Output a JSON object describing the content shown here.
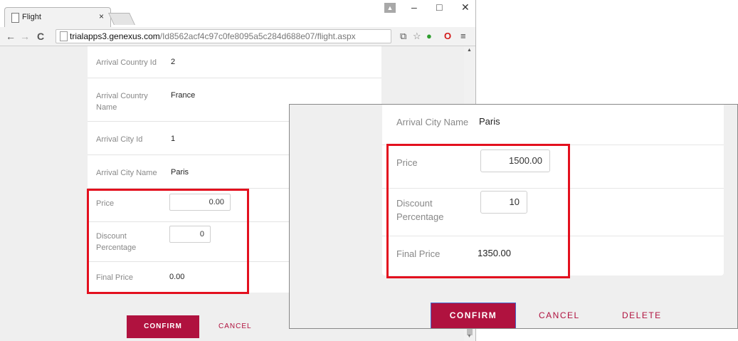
{
  "browser": {
    "tab_title": "Flight",
    "tab_close": "×",
    "url_prefix": "trialapps3.genexus.com",
    "url_path": "/Id8562acf4c97c0fe8095a5c284d688e07/flight.aspx",
    "minimize": "–",
    "maximize": "□",
    "close": "✕",
    "back": "←",
    "forward": "→",
    "reload": "C",
    "menu": "≡"
  },
  "form": {
    "rows": [
      {
        "label": "Arrival Country Id",
        "value": "2"
      },
      {
        "label": "Arrival Country Name",
        "value": "France"
      },
      {
        "label": "Arrival City Id",
        "value": "1"
      },
      {
        "label": "Arrival City Name",
        "value": "Paris"
      }
    ],
    "price_label": "Price",
    "price_value": "0.00",
    "discount_label": "Discount Percentage",
    "discount_value": "0",
    "final_price_label": "Final Price",
    "final_price_value": "0.00",
    "confirm_label": "CONFIRM",
    "cancel_label": "CANCEL"
  },
  "zoom": {
    "city_label": "Arrival City Name",
    "city_value": "Paris",
    "price_label": "Price",
    "price_value": "1500.00",
    "discount_label": "Discount Percentage",
    "discount_value": "10",
    "final_price_label": "Final Price",
    "final_price_value": "1350.00",
    "confirm_label": "CONFIRM",
    "cancel_label": "CANCEL",
    "delete_label": "DELETE"
  },
  "colors": {
    "accent": "#b0123f",
    "highlight": "#e3101e"
  }
}
